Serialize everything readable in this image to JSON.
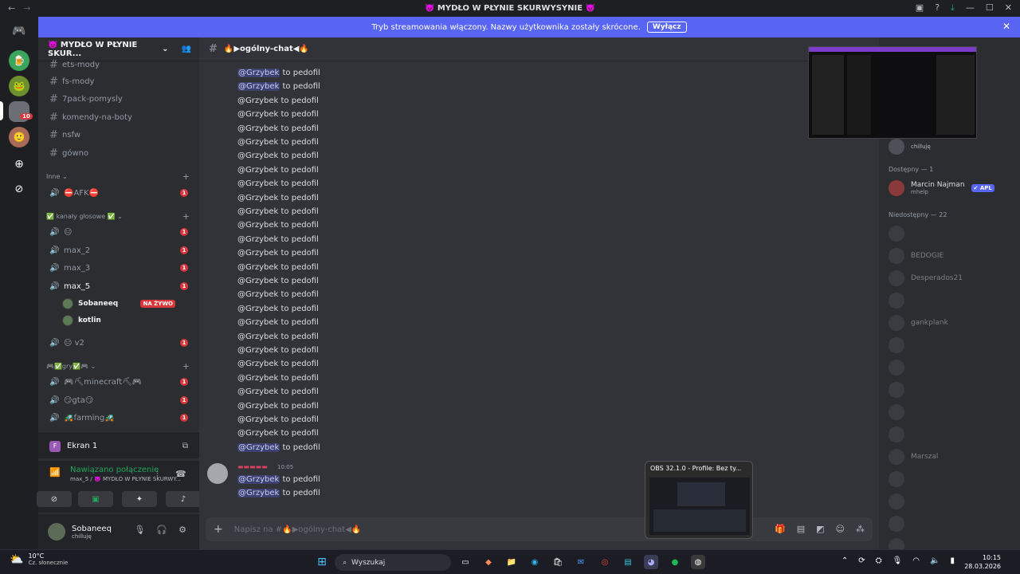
{
  "window": {
    "title": "👿 MYDŁO W PŁYNIE SKURWYSYNIE 👿"
  },
  "banner": {
    "text": "Tryb streamowania włączony. Nazwy użytkownika zostały skrócone.",
    "button": "Wyłącz"
  },
  "server": {
    "name": "👿 MYDŁO W PŁYNIE SKUR...",
    "rail_badge": "10"
  },
  "channels": {
    "text": [
      "ets-mody",
      "fs-mody",
      "7pack-pomysly",
      "komendy-na-boty",
      "nsfw",
      "gówno"
    ],
    "cat_inne": "Inne",
    "afk": "⛔AFK⛔",
    "cat_voice": "✅ kanały głosowe ✅",
    "voice": [
      "😑",
      "max_2",
      "max_3",
      "max_5"
    ],
    "voice_users": [
      {
        "name": "Sobaneeq",
        "live": "NA ŻYWO"
      },
      {
        "name": "kotlin"
      }
    ],
    "v2": "😑 v2",
    "cat_gry": "🎮✅gry✅🎮",
    "games": [
      "🎮⛏minecraft⛏🎮",
      "😏gta😏",
      "🚜farming🚜"
    ],
    "badge": "1"
  },
  "ekran": {
    "icon": "F",
    "label": "Ekran 1"
  },
  "voice_panel": {
    "status": "Nawiązano połączenie",
    "sub": "max_5 / 👿 MYDŁO W PŁYNIE SKURWY..."
  },
  "user": {
    "name": "Sobaneeq",
    "status": "chilluję"
  },
  "chat": {
    "channel": "🔥▶ogólny-chat◀🔥",
    "mention": "@Grzybek",
    "text": " to pedofil",
    "last_time": "10:05",
    "placeholder": "Napisz na #🔥▶ogólny-chat◀🔥"
  },
  "members": {
    "top_status": "chilluję",
    "available": "Dostępny — 1",
    "m1": {
      "name": "Marcin Najman",
      "tag": "✔ APL",
      "sub": "mhelp"
    },
    "unavailable": "Niedostępny — 22",
    "names": [
      "",
      "BEDOGIE",
      "Desperados21",
      "",
      "gankplank",
      "",
      "",
      "",
      "",
      "",
      "Marszal",
      "",
      "",
      "",
      "",
      "",
      ""
    ]
  },
  "obs": {
    "title": "OBS 32.1.0 - Profile: Bez ty..."
  },
  "taskbar": {
    "temp": "10°C",
    "weather": "Cz. słonecznie",
    "search": "Wyszukaj",
    "time": "10:15",
    "date": "28.03.2026"
  }
}
